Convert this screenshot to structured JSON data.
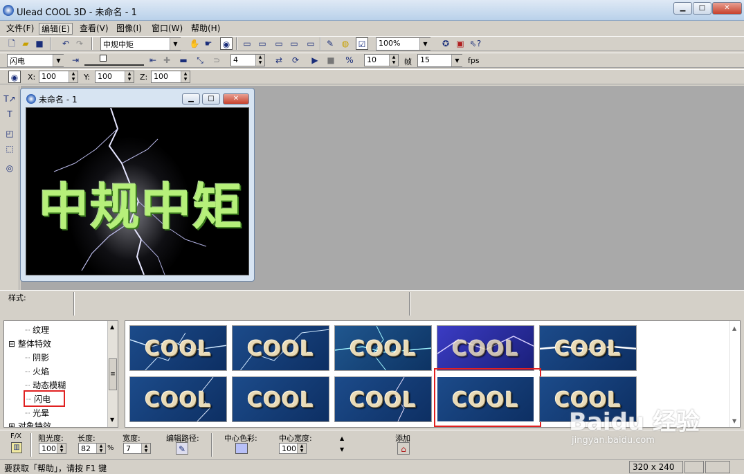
{
  "window": {
    "title": "Ulead COOL 3D - 未命名 - 1"
  },
  "menu": [
    "文件(F)",
    "编辑(E)",
    "查看(V)",
    "图像(I)",
    "窗口(W)",
    "帮助(H)"
  ],
  "toolbar1": {
    "text_combo": "中规中矩",
    "zoom": "100%"
  },
  "toolbar2": {
    "effect_combo": "闪电",
    "frames_spin": "4",
    "speed_spin": "10",
    "frame_label": "帧",
    "fps_combo": "15",
    "fps_label": "fps"
  },
  "toolbar3": {
    "x_label": "X:",
    "x_value": "100",
    "y_label": "Y:",
    "y_value": "100",
    "z_label": "Z:",
    "z_value": "100"
  },
  "child_window": {
    "title": "未命名 - 1",
    "canvas_text": "中规中矩"
  },
  "style_bar": {
    "label": "样式:"
  },
  "tree": {
    "items": [
      {
        "label": "纹理",
        "indent": 2
      },
      {
        "label": "整体特效",
        "indent": 1,
        "expander": "⊟"
      },
      {
        "label": "阴影",
        "indent": 2
      },
      {
        "label": "火焰",
        "indent": 2
      },
      {
        "label": "动态模糊",
        "indent": 2
      },
      {
        "label": "闪电",
        "indent": 2,
        "selected": true
      },
      {
        "label": "光晕",
        "indent": 2
      },
      {
        "label": "对象特效",
        "indent": 1,
        "expander": "⊞"
      }
    ]
  },
  "gallery": {
    "thumb_text": "COOL",
    "count": 10,
    "selected_index": 8
  },
  "props": {
    "fx_label": "F/X",
    "glow_label": "阻光度:",
    "glow_value": "100",
    "length_label": "长度:",
    "length_value": "82",
    "length_unit": "%",
    "width_label": "宽度:",
    "width_value": "7",
    "path_label": "编辑路径:",
    "center_color_label": "中心色彩:",
    "center_width_label": "中心宽度:",
    "center_width_value": "100",
    "add_label": "添加"
  },
  "status": {
    "help": "要获取「帮助」，请按 F1 键",
    "size": "320 x 240"
  },
  "watermark": {
    "line1": "Baidu 经验",
    "line2": "jingyan.baidu.com"
  }
}
